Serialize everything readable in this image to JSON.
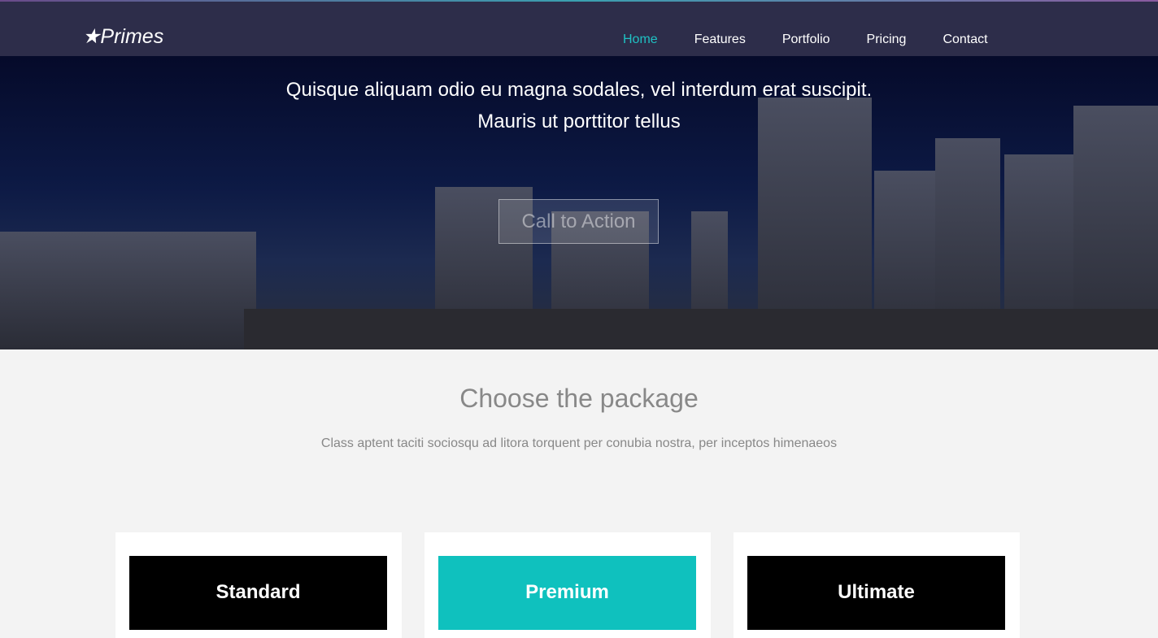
{
  "brand": {
    "logo": "★Primes"
  },
  "nav": {
    "items": [
      "Home",
      "Features",
      "Portfolio",
      "Pricing",
      "Contact"
    ],
    "active": "Home"
  },
  "hero": {
    "line1": "Quisque aliquam odio eu magna sodales, vel interdum erat suscipit.",
    "line2": "Mauris ut porttitor tellus",
    "cta": "Call to Action"
  },
  "pricing": {
    "title": "Choose the package",
    "subtitle": "Class aptent taciti sociosqu ad litora torquent per conubia nostra, per inceptos himenaeos",
    "packages": [
      "Standard",
      "Premium",
      "Ultimate"
    ]
  },
  "colors": {
    "accent": "#0fc1be",
    "nav_bg": "#2d2d4a"
  }
}
